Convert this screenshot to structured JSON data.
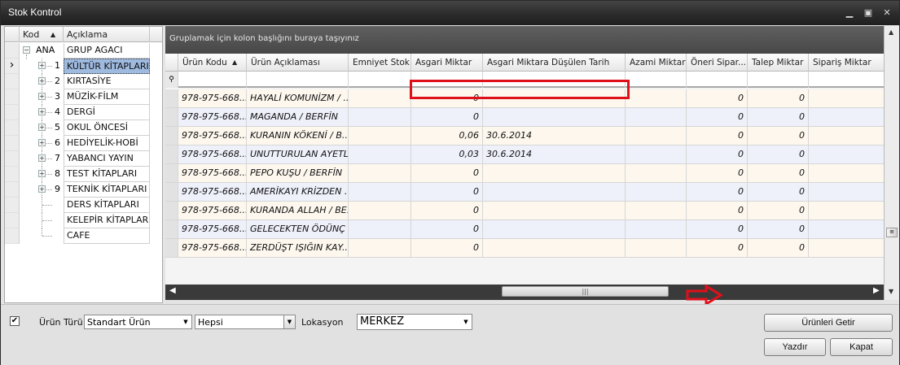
{
  "window": {
    "title": "Stok Kontrol"
  },
  "tree": {
    "headers": {
      "code": "Kod",
      "desc": "Açıklama"
    },
    "root": {
      "code": "ANA",
      "desc": "GRUP AGACI"
    },
    "items": [
      {
        "code": "1",
        "desc": "KÜLTÜR KİTAPLARI"
      },
      {
        "code": "2",
        "desc": "KIRTASİYE"
      },
      {
        "code": "3",
        "desc": "MÜZİK-FİLM"
      },
      {
        "code": "4",
        "desc": "DERGİ"
      },
      {
        "code": "5",
        "desc": "OKUL ÖNCESİ"
      },
      {
        "code": "6",
        "desc": "HEDİYELİK-HOBİ"
      },
      {
        "code": "7",
        "desc": "YABANCI YAYIN"
      },
      {
        "code": "8",
        "desc": "TEST KİTAPLARI"
      },
      {
        "code": "9",
        "desc": "TEKNİK KİTAPLARI"
      },
      {
        "code": "",
        "desc": "DERS KİTAPLARI"
      },
      {
        "code": "",
        "desc": "KELEPİR KİTAPLAR"
      },
      {
        "code": "",
        "desc": "CAFE"
      }
    ]
  },
  "grid": {
    "group_hint": "Gruplamak için kolon başlığını buraya taşıyınız",
    "columns": [
      "Ürün Kodu",
      "Ürün Açıklaması",
      "Emniyet Stok",
      "Asgari Miktar",
      "Asgari Miktara Düşülen Tarih",
      "Azami Miktar",
      "Öneri Sipar...",
      "Talep Miktar",
      "Sipariş Miktar"
    ],
    "rows": [
      {
        "code": "978-975-668...",
        "desc": "HAYALİ KOMUNİZM / ...",
        "min": "0",
        "date": "",
        "sug": "0",
        "req": "0"
      },
      {
        "code": "978-975-668...",
        "desc": "MAGANDA / BERFİN",
        "min": "0",
        "date": "",
        "sug": "0",
        "req": "0"
      },
      {
        "code": "978-975-668...",
        "desc": "KURANIN KÖKENİ / B...",
        "min": "0,06",
        "date": "30.6.2014",
        "sug": "0",
        "req": "0"
      },
      {
        "code": "978-975-668...",
        "desc": "UNUTTURULAN AYETL...",
        "min": "0,03",
        "date": "30.6.2014",
        "sug": "0",
        "req": "0"
      },
      {
        "code": "978-975-668...",
        "desc": "PEPO KUŞU / BERFİN",
        "min": "0",
        "date": "",
        "sug": "0",
        "req": "0"
      },
      {
        "code": "978-975-668...",
        "desc": "AMERİKAYI KRİZDEN ...",
        "min": "0",
        "date": "",
        "sug": "0",
        "req": "0"
      },
      {
        "code": "978-975-668...",
        "desc": "KURANDA ALLAH / BE...",
        "min": "0",
        "date": "",
        "sug": "0",
        "req": "0"
      },
      {
        "code": "978-975-668...",
        "desc": "GELECEKTEN ÖDÜNÇ ...",
        "min": "0",
        "date": "",
        "sug": "0",
        "req": "0"
      },
      {
        "code": "978-975-668...",
        "desc": "ZERDÜŞT IŞIĞIN KAY...",
        "min": "0",
        "date": "",
        "sug": "0",
        "req": "0"
      }
    ]
  },
  "filters": {
    "urun_turu_label": "Ürün Türü",
    "urun_turu_value": "Standart Ürün",
    "scope_value": "Hepsi",
    "lokasyon_label": "Lokasyon",
    "lokasyon_value": "MERKEZ"
  },
  "buttons": {
    "fetch": "Ürünleri Getir",
    "print": "Yazdır",
    "close": "Kapat"
  },
  "colors": {
    "highlight": "#e0101a",
    "selection": "#9fbadf"
  }
}
